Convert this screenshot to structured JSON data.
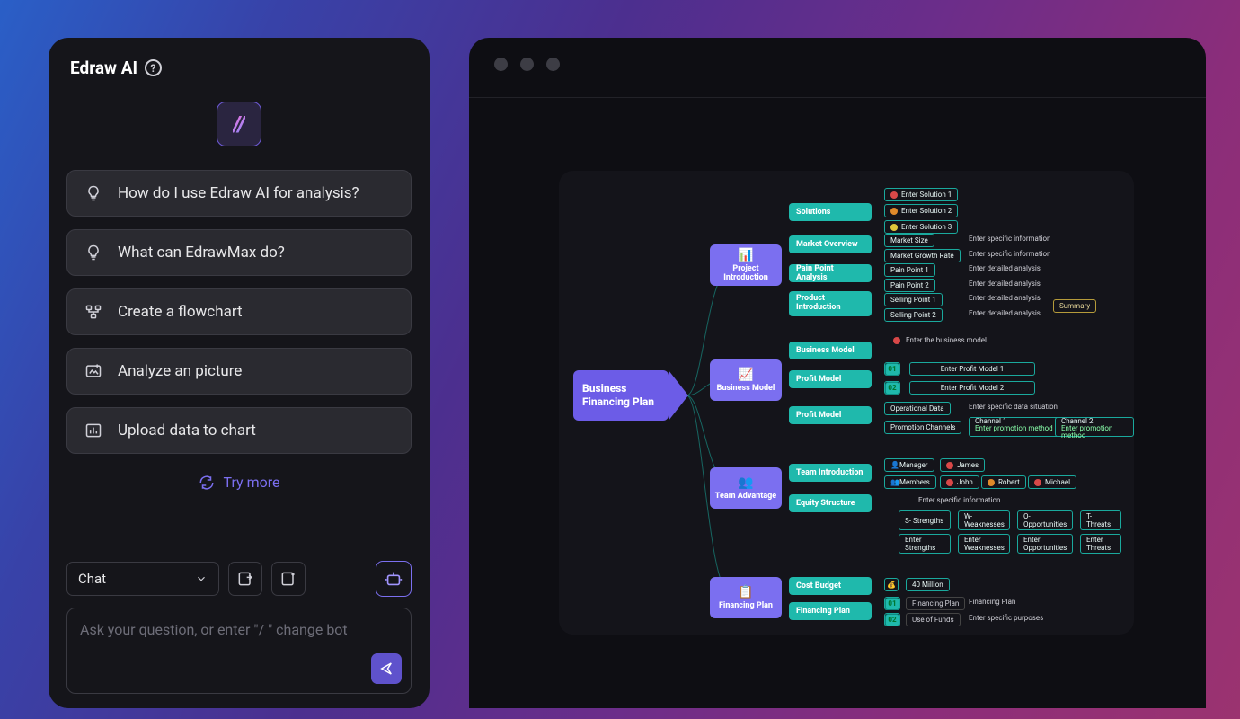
{
  "brand": {
    "title": "Edraw AI"
  },
  "suggestions": [
    {
      "icon": "lightbulb-icon",
      "label": "How do I use Edraw AI for analysis?"
    },
    {
      "icon": "lightbulb-icon",
      "label": "What can EdrawMax do?"
    },
    {
      "icon": "flowchart-icon",
      "label": "Create a flowchart"
    },
    {
      "icon": "image-analyze-icon",
      "label": "Analyze an picture"
    },
    {
      "icon": "upload-chart-icon",
      "label": "Upload data to chart"
    }
  ],
  "try_more": "Try more",
  "chat_select": {
    "value": "Chat"
  },
  "input": {
    "placeholder": "Ask your question, or enter   \"/  \" change bot"
  },
  "mindmap": {
    "root": "Business Financing Plan",
    "branches": [
      {
        "title": "Project Introduction",
        "emoji": "📊",
        "rows": [
          {
            "label": "Solutions",
            "chips": [
              "Enter Solution 1",
              "Enter Solution 2",
              "Enter Solution 3"
            ],
            "bullets": [
              "r",
              "o",
              "y"
            ]
          },
          {
            "label": "Market Overview",
            "chips": [
              "Market Size",
              "Market Growth Rate"
            ],
            "tails": [
              "Enter specific information",
              "Enter specific information"
            ]
          },
          {
            "label": "Pain Point Analysis",
            "chips": [
              "Pain Point 1",
              "Pain Point 2"
            ],
            "tails": [
              "Enter detailed analysis",
              "Enter detailed analysis"
            ]
          },
          {
            "label": "Product Introduction",
            "chips": [
              "Selling Point 1",
              "Selling Point 2"
            ],
            "tails": [
              "Enter detailed analysis",
              "Enter detailed analysis"
            ],
            "summary": "Summary"
          }
        ]
      },
      {
        "title": "Business Model",
        "emoji": "📈",
        "rows": [
          {
            "label": "Business Model",
            "tails": [
              "Enter the business model"
            ]
          },
          {
            "label": "Profit Model",
            "nums": [
              "01",
              "02"
            ],
            "pill": [
              "Enter Profit Model 1",
              "Enter Profit Model 2"
            ]
          },
          {
            "label": "Profit Model",
            "chips": [
              "Operational Data",
              "Promotion Channels"
            ],
            "tails": [
              "Enter specific data situation"
            ],
            "channels": [
              [
                "Channel 1",
                "Enter promotion method"
              ],
              [
                "Channel 2",
                "Enter promotion method"
              ]
            ]
          }
        ]
      },
      {
        "title": "Team Advantage",
        "emoji": "👥",
        "rows": [
          {
            "label": "Team Introduction",
            "people": [
              [
                "Manager",
                "James"
              ],
              [
                "Members",
                "John",
                "Robert",
                "Michael"
              ]
            ]
          },
          {
            "label": "Equity Structure",
            "grid_title": "Enter specific information",
            "grid": [
              [
                "S- Strengths",
                "W- Weaknesses",
                "O- Opportunities",
                "T- Threats"
              ],
              [
                "Enter Strengths",
                "Enter Weaknesses",
                "Enter Opportunities",
                "Enter Threats"
              ]
            ]
          }
        ]
      },
      {
        "title": "Financing Plan",
        "emoji": "📋",
        "rows": [
          {
            "label": "Cost Budget",
            "amount": "40 Million"
          },
          {
            "label": "Financing Plan",
            "nums": [
              "01",
              "02"
            ],
            "subchips": [
              [
                "Financing Plan",
                "Financing Plan"
              ],
              [
                "Use of Funds",
                "Enter specific purposes"
              ]
            ]
          }
        ]
      }
    ]
  }
}
